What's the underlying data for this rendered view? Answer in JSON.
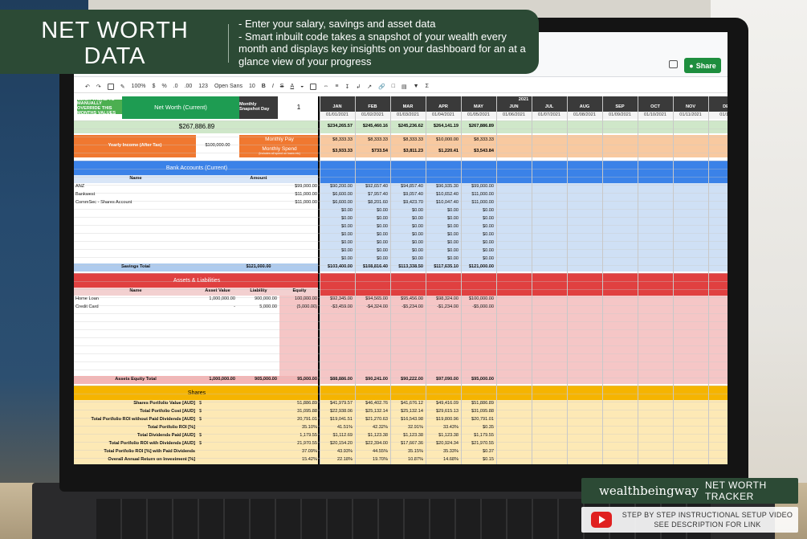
{
  "banner": {
    "title": "NET WORTH DATA",
    "bullets": [
      "- Enter your salary, savings and asset data",
      "- Smart inbuilt code takes a snapshot of your wealth every month and displays key insights on your dashboard for an at a glance view of your progress"
    ]
  },
  "toolbar": {
    "zoom": "100%",
    "currency": "$",
    "percent": "%",
    "decimals": ".0",
    "decimals2": ".00",
    "format": "123",
    "font": "Open Sans",
    "size": "10",
    "share_label": "Share"
  },
  "sheet": {
    "overwrite_btn": "CLICK THERE TO MANUALLY OVERRIDE THIS MONTHS VALUES",
    "net_worth_label": "Net Worth (Current)",
    "snapshot_label": "Monthly Snapshot Day",
    "snapshot_value": "1",
    "net_worth_value": "$267,886.89",
    "yearly_income_label": "Yearly Income (After Tax)",
    "yearly_income_value": "$100,000.00",
    "monthly_pay_label": "Monthly Pay",
    "monthly_spend_label": "Monthly Spend",
    "monthly_spend_note": "(Includes all spend on loans etc)",
    "year": "2021",
    "months": [
      "JAN",
      "FEB",
      "MAR",
      "APR",
      "MAY",
      "JUN",
      "JUL",
      "AUG",
      "SEP",
      "OCT",
      "NOV",
      "DE"
    ],
    "dates": [
      "01/01/2021",
      "01/02/2021",
      "01/03/2021",
      "01/04/2021",
      "01/05/2021",
      "01/06/2021",
      "01/07/2021",
      "01/08/2021",
      "01/09/2021",
      "01/10/2021",
      "01/11/2021",
      "01/12/"
    ],
    "net_worth_row": [
      "$234,265.57",
      "$245,460.16",
      "$245,236.62",
      "$264,141.19",
      "$267,886.89"
    ],
    "pay_row": [
      "$8,333.33",
      "$8,333.33",
      "$8,333.33",
      "$10,000.00",
      "$8,333.33"
    ],
    "spend_row": [
      "$3,933.33",
      "$733.54",
      "$3,811.23",
      "$1,220.41",
      "$3,543.84"
    ],
    "bank": {
      "title": "Bank Accounts (Current)",
      "col_name": "Name",
      "col_amount": "Amount",
      "rows": [
        {
          "name": "ANZ",
          "amount": "$99,000.00",
          "hist": [
            "$90,200.00",
            "$92,657.40",
            "$94,857.40",
            "$96,935.30",
            "$99,000.00"
          ]
        },
        {
          "name": "Bankwest",
          "amount": "$11,000.00",
          "hist": [
            "$6,600.00",
            "$7,957.40",
            "$9,057.40",
            "$10,652.40",
            "$11,000.00"
          ]
        },
        {
          "name": "CommSec - Shares Account",
          "amount": "$11,000.00",
          "hist": [
            "$6,600.00",
            "$8,201.60",
            "$9,423.70",
            "$10,047.40",
            "$11,000.00"
          ]
        }
      ],
      "zero": "$0.00",
      "total_label": "Savings Total",
      "total_value": "$121,000.00",
      "total_hist": [
        "$103,400.00",
        "$108,816.40",
        "$113,338.50",
        "$117,635.10",
        "$121,000.00"
      ]
    },
    "assets": {
      "title": "Assets & Liabilities",
      "col_name": "Name",
      "col_asset": "Asset Value",
      "col_liab": "Liability",
      "col_equity": "Equity",
      "rows": [
        {
          "name": "Home Loan",
          "asset": "1,000,000.00",
          "liab": "900,000.00",
          "equity": "100,000.00",
          "hist": [
            "$92,345.00",
            "$94,565.00",
            "$95,456.00",
            "$98,324.00",
            "$100,000.00"
          ]
        },
        {
          "name": "Credit Card",
          "asset": "-",
          "liab": "5,000.00",
          "equity": "(5,000.00)",
          "hist": [
            "-$3,459.00",
            "-$4,324.00",
            "-$5,234.00",
            "-$1,234.00",
            "-$5,000.00"
          ]
        }
      ],
      "total_label": "Assets Equity Total",
      "total_asset": "1,000,000.00",
      "total_liab": "905,000.00",
      "total_equity": "95,000.00",
      "total_hist": [
        "$88,886.00",
        "$90,241.00",
        "$90,222.00",
        "$97,090.00",
        "$95,000.00"
      ]
    },
    "shares": {
      "title": "Shares",
      "rows": [
        {
          "label": "Shares Portfolio Value [AUD]",
          "dollar": "$",
          "value": "51,886.89",
          "hist": [
            "$41,979.57",
            "$46,402.76",
            "$41,676.12",
            "$49,416.09",
            "$51,886.89"
          ]
        },
        {
          "label": "Total Portfolio Cost [AUD]",
          "dollar": "$",
          "value": "31,095.88",
          "hist": [
            "$22,938.06",
            "$25,132.14",
            "$25,132.14",
            "$29,615.13",
            "$31,095.88"
          ]
        },
        {
          "label": "Total Portfolio ROI without Paid Dividends [AUD]",
          "dollar": "$",
          "value": "20,791.01",
          "hist": [
            "$19,041.51",
            "$21,270.63",
            "$16,543.98",
            "$19,800.96",
            "$20,791.01"
          ]
        },
        {
          "label": "Total Portfolio ROI [%]",
          "dollar": "",
          "value": "35.10%",
          "hist": [
            "41.51%",
            "42.32%",
            "32.91%",
            "33.43%",
            "$0.35"
          ]
        },
        {
          "label": "Total Dividends Paid [AUD]",
          "dollar": "$",
          "value": "1,179.55",
          "hist": [
            "$1,112.69",
            "$1,123.38",
            "$1,123.38",
            "$1,123.38",
            "$1,179.55"
          ]
        },
        {
          "label": "Total Portfolio ROI with Dividends [AUD]",
          "dollar": "$",
          "value": "21,970.55",
          "hist": [
            "$20,154.20",
            "$22,394.00",
            "$17,667.36",
            "$20,924.34",
            "$21,970.55"
          ]
        },
        {
          "label": "Total Portfolio ROI [%] with Paid Dividends",
          "dollar": "",
          "value": "37.09%",
          "hist": [
            "43.93%",
            "44.55%",
            "35.15%",
            "35.33%",
            "$0.37"
          ]
        },
        {
          "label": "Overall Annual Return on Investment [%]",
          "dollar": "",
          "value": "15.42%",
          "hist": [
            "22.18%",
            "19.70%",
            "10.87%",
            "14.68%",
            "$0.15"
          ]
        }
      ]
    }
  },
  "brand": {
    "name": "wealthbeingway",
    "tagline": "NET WORTH TRACKER",
    "video_line1": "STEP BY STEP INSTRUCTIONAL SETUP VIDEO",
    "video_line2": "SEE DESCRIPTION FOR LINK"
  },
  "colors": {
    "green_header": "#1e9c52",
    "orange": "#f07830",
    "blue": "#3b82e8",
    "red": "#e04040",
    "amber": "#f5b400",
    "light_green": "#cfe7c9",
    "light_orange": "#f8c9a0",
    "light_blue": "#cfe0f5",
    "light_red": "#f5c6c6",
    "light_yellow": "#fde9b5",
    "dark_panel": "#2c4a35"
  }
}
